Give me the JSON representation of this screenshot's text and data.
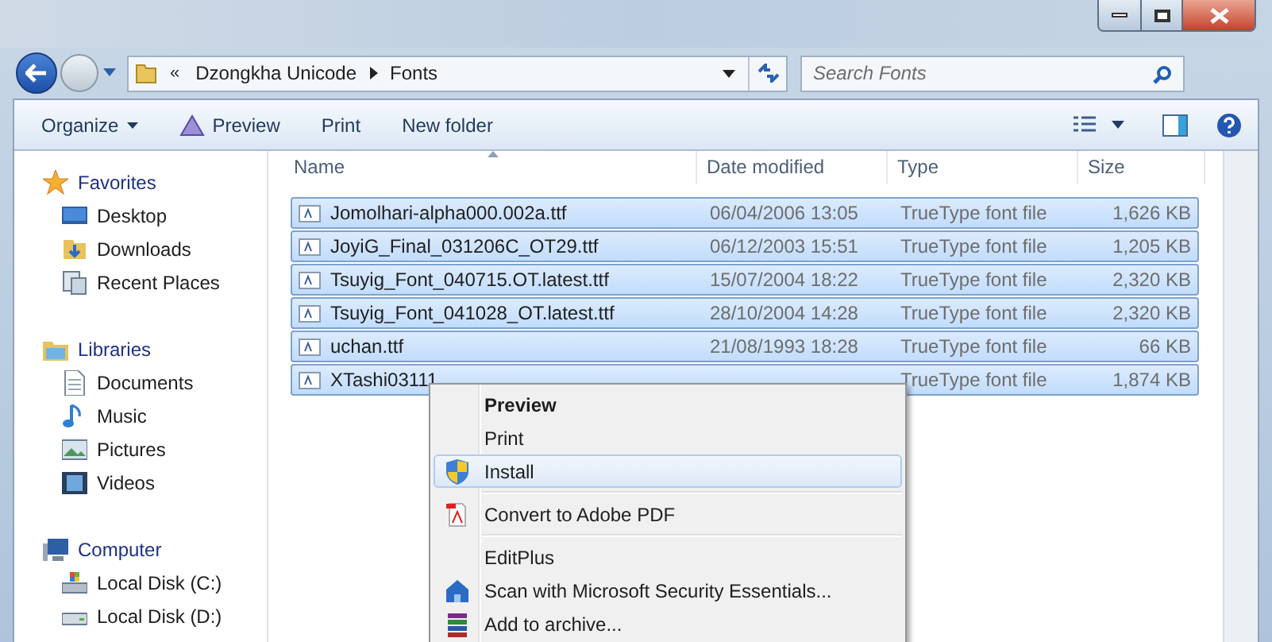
{
  "address": {
    "overflow": "«",
    "path": [
      "Dzongkha Unicode",
      "Fonts"
    ]
  },
  "search": {
    "placeholder": "Search Fonts"
  },
  "toolbar": [
    {
      "label": "Organize",
      "kind": "menu"
    },
    {
      "label": "Preview",
      "kind": "preview"
    },
    {
      "label": "Print",
      "kind": "plain"
    },
    {
      "label": "New folder",
      "kind": "plain"
    }
  ],
  "sidebar": [
    {
      "label": "Favorites",
      "kind": "star",
      "children": [
        {
          "label": "Desktop",
          "kind": "desktop"
        },
        {
          "label": "Downloads",
          "kind": "downloads"
        },
        {
          "label": "Recent Places",
          "kind": "recent"
        }
      ]
    },
    {
      "label": "Libraries",
      "kind": "library",
      "children": [
        {
          "label": "Documents",
          "kind": "document"
        },
        {
          "label": "Music",
          "kind": "music"
        },
        {
          "label": "Pictures",
          "kind": "pictures"
        },
        {
          "label": "Videos",
          "kind": "videos"
        }
      ]
    },
    {
      "label": "Computer",
      "kind": "computer",
      "children": [
        {
          "label": "Local Disk (C:)",
          "kind": "system-disk"
        },
        {
          "label": "Local Disk (D:)",
          "kind": "disk"
        }
      ]
    }
  ],
  "table": {
    "columns": [
      "Name",
      "Date modified",
      "Type",
      "Size"
    ],
    "rows": [
      {
        "name": "Jomolhari-alpha000.002a.ttf",
        "date": "06/04/2006 13:05",
        "type": "TrueType font file",
        "size": "1,626 KB",
        "selected": true
      },
      {
        "name": "JoyiG_Final_031206C_OT29.ttf",
        "date": "06/12/2003 15:51",
        "type": "TrueType font file",
        "size": "1,205 KB",
        "selected": true
      },
      {
        "name": "Tsuyig_Font_040715.OT.latest.ttf",
        "date": "15/07/2004 18:22",
        "type": "TrueType font file",
        "size": "2,320 KB",
        "selected": true
      },
      {
        "name": "Tsuyig_Font_041028_OT.latest.ttf",
        "date": "28/10/2004 14:28",
        "type": "TrueType font file",
        "size": "2,320 KB",
        "selected": true
      },
      {
        "name": "uchan.ttf",
        "date": "21/08/1993 18:28",
        "type": "TrueType font file",
        "size": "66 KB",
        "selected": true
      },
      {
        "name": "XTashi03111",
        "type": "TrueType font file",
        "size": "1,874 KB",
        "selected": true
      }
    ]
  },
  "context_menu": {
    "groups": [
      [
        {
          "label": "Preview",
          "kind": "none",
          "default": true,
          "selected": false
        },
        {
          "label": "Print",
          "kind": "none",
          "default": false,
          "selected": false
        },
        {
          "label": "Install",
          "kind": "shield",
          "default": false,
          "selected": true
        }
      ],
      [
        {
          "label": "Convert to Adobe PDF",
          "kind": "pdf",
          "default": false,
          "selected": false
        }
      ],
      [
        {
          "label": "EditPlus",
          "kind": "none",
          "default": false,
          "selected": false
        },
        {
          "label": "Scan with Microsoft Security Essentials...",
          "kind": "house",
          "default": false,
          "selected": false
        },
        {
          "label": "Add to archive...",
          "kind": "archive",
          "default": false,
          "selected": false
        }
      ]
    ]
  }
}
